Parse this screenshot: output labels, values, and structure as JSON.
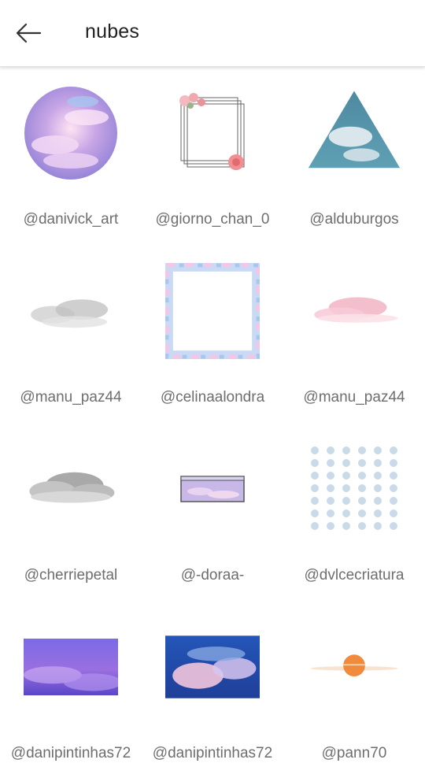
{
  "header": {
    "back_icon": "arrow-left-icon",
    "title": "nubes"
  },
  "grid": [
    [
      {
        "username": "@danivick_art",
        "image": "pastel-cloud-circle"
      },
      {
        "username": "@giorno_chan_0",
        "image": "rose-frame"
      },
      {
        "username": "@alduburgos",
        "image": "cloud-triangle"
      }
    ],
    [
      {
        "username": "@manu_paz44",
        "image": "grey-cloud"
      },
      {
        "username": "@celinaalondra",
        "image": "cloud-square-frame"
      },
      {
        "username": "@manu_paz44",
        "image": "pink-cloud"
      }
    ],
    [
      {
        "username": "@cherriepetal",
        "image": "grey-cloud-puff"
      },
      {
        "username": "@-doraa-",
        "image": "cloud-window"
      },
      {
        "username": "@dvlcecriatura",
        "image": "cloud-icon-pattern"
      }
    ],
    [
      {
        "username": "@danipintinhas72",
        "image": "purple-sea-of-clouds"
      },
      {
        "username": "@danipintinhas72",
        "image": "blue-pink-clouds"
      },
      {
        "username": "@pann70",
        "image": "sunset-sun"
      }
    ]
  ]
}
